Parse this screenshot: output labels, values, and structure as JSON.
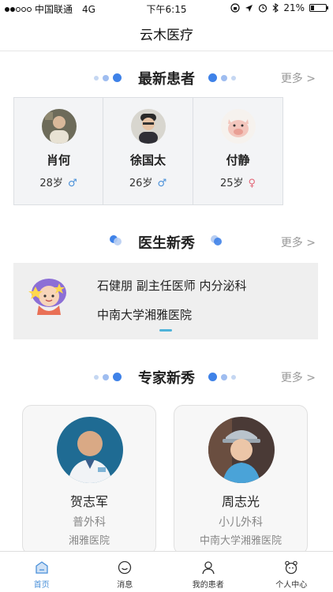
{
  "status_bar": {
    "carrier": "中国联通",
    "network": "4G",
    "time": "下午6:15",
    "battery": "21%",
    "battery_level": 0.21
  },
  "nav": {
    "title": "云木医疗"
  },
  "latest_patients": {
    "title": "最新患者",
    "more": "更多 >",
    "items": [
      {
        "name": "肖何",
        "age": "28岁",
        "gender_symbol": "♂"
      },
      {
        "name": "徐国太",
        "age": "26岁",
        "gender_symbol": "♂"
      },
      {
        "name": "付静",
        "age": "25岁",
        "gender_symbol": "♀"
      }
    ]
  },
  "doctor_showcase": {
    "title": "医生新秀",
    "more": "更多 >",
    "line1": "石健朋  副主任医师  内分泌科",
    "line2": "中南大学湘雅医院"
  },
  "expert_showcase": {
    "title": "专家新秀",
    "more": "更多 >",
    "items": [
      {
        "name": "贺志军",
        "department": "普外科",
        "hospital": "湘雅医院"
      },
      {
        "name": "周志光",
        "department": "小儿外科",
        "hospital": "中南大学湘雅医院"
      }
    ]
  },
  "tab_bar": {
    "items": [
      {
        "label": "首页",
        "icon": "home-icon",
        "active": true
      },
      {
        "label": "消息",
        "icon": "chat-icon",
        "active": false
      },
      {
        "label": "我的患者",
        "icon": "patients-icon",
        "active": false
      },
      {
        "label": "个人中心",
        "icon": "profile-icon",
        "active": false
      }
    ]
  },
  "colors": {
    "accent": "#3f82e8",
    "male": "#4a90d9",
    "female": "#e36a7a"
  }
}
